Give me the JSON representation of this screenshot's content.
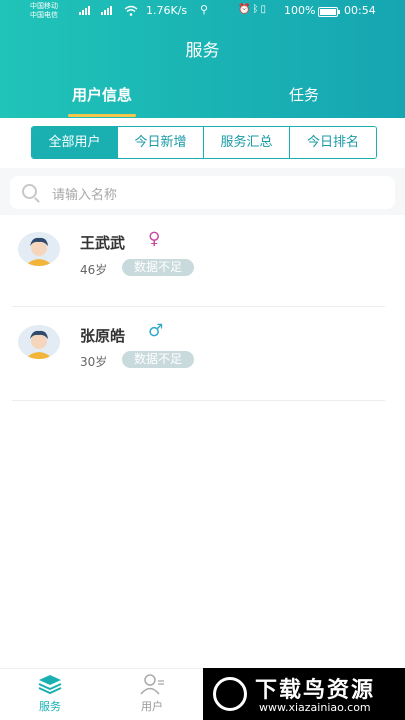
{
  "status_bar": {
    "carrier_1": "中国移动",
    "carrier_2": "中国电信",
    "network_speed": "1.76K/s",
    "battery": "100%",
    "time": "00:54"
  },
  "header": {
    "title": "服务",
    "tabs": [
      {
        "label": "用户信息",
        "active": true
      },
      {
        "label": "任务",
        "active": false
      }
    ],
    "accent_color": "#1ab0b2"
  },
  "filters": [
    {
      "label": "全部用户",
      "active": true
    },
    {
      "label": "今日新增",
      "active": false
    },
    {
      "label": "服务汇总",
      "active": false
    },
    {
      "label": "今日排名",
      "active": false
    }
  ],
  "search": {
    "placeholder": "请输入名称"
  },
  "users": [
    {
      "name": "王武武",
      "gender_symbol": "♀",
      "gender_color": "#c84b9e",
      "age": "46岁",
      "tag": "数据不足"
    },
    {
      "name": "张原皓",
      "gender_symbol": "♂",
      "gender_color": "#2fa9c8",
      "age": "30岁",
      "tag": "数据不足"
    }
  ],
  "bottom_nav": [
    {
      "label": "服务",
      "icon": "layers-icon",
      "active": true
    },
    {
      "label": "用户",
      "icon": "user-icon",
      "active": false
    }
  ],
  "watermark": {
    "title": "下载鸟资源",
    "url": "www.xiazainiao.com"
  }
}
